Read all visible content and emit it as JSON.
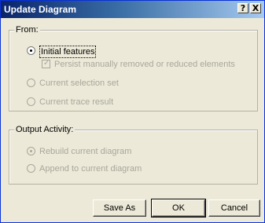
{
  "window": {
    "title": "Update Diagram"
  },
  "titlebar_buttons": {
    "help_label": "?",
    "close_label": "X"
  },
  "from_group": {
    "label": "From:",
    "options": [
      {
        "label": "Initial features",
        "selected": true,
        "enabled": true
      },
      {
        "label": "Current selection set",
        "selected": false,
        "enabled": false
      },
      {
        "label": "Current trace result",
        "selected": false,
        "enabled": false
      }
    ],
    "persist_checkbox": {
      "label": "Persist manually removed or reduced elements",
      "checked": true,
      "enabled": false
    }
  },
  "output_group": {
    "label": "Output Activity:",
    "options": [
      {
        "label": "Rebuild current diagram",
        "selected": true,
        "enabled": false
      },
      {
        "label": "Append to current diagram",
        "selected": false,
        "enabled": false
      }
    ]
  },
  "buttons": {
    "save_as": "Save As",
    "ok": "OK",
    "cancel": "Cancel"
  },
  "colors": {
    "title_start": "#0a246a",
    "title_end": "#a6caf0",
    "dialog_bg": "#ece9d8",
    "disabled_text": "#a9a79c"
  }
}
